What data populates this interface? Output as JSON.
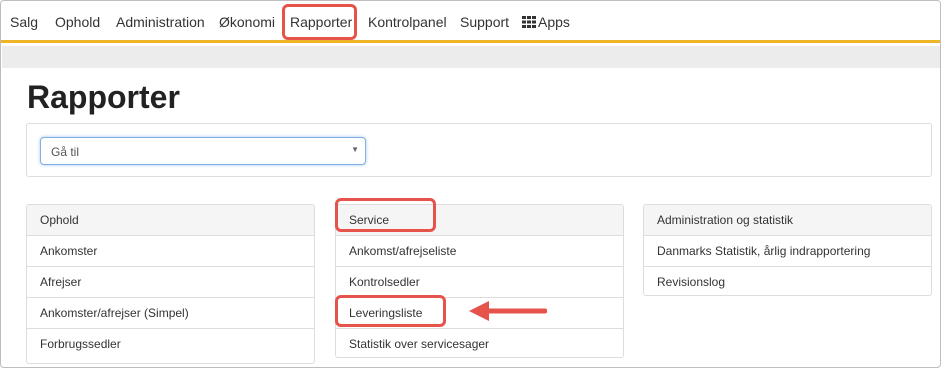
{
  "nav": {
    "items": [
      "Salg",
      "Ophold",
      "Administration",
      "Økonomi",
      "Rapporter",
      "Kontrolpanel",
      "Support"
    ],
    "apps_label": "Apps",
    "apps_icon": "grid-icon",
    "active": "Rapporter"
  },
  "page": {
    "title": "Rapporter"
  },
  "goto": {
    "placeholder": "Gå til"
  },
  "panels": {
    "ophold": {
      "title": "Ophold",
      "items": [
        "Ankomster",
        "Afrejser",
        "Ankomster/afrejser (Simpel)",
        "Forbrugssedler"
      ]
    },
    "service": {
      "title": "Service",
      "items": [
        "Ankomst/afrejseliste",
        "Kontrolsedler",
        "Leveringsliste",
        "Statistik over servicesager"
      ]
    },
    "admin": {
      "title": "Administration og statistik",
      "items": [
        "Danmarks Statistik, årlig indrapportering",
        "Revisionslog"
      ]
    }
  },
  "colors": {
    "accent": "#f0b429",
    "highlight": "#e5534b",
    "select_border": "#7fb0e2"
  }
}
